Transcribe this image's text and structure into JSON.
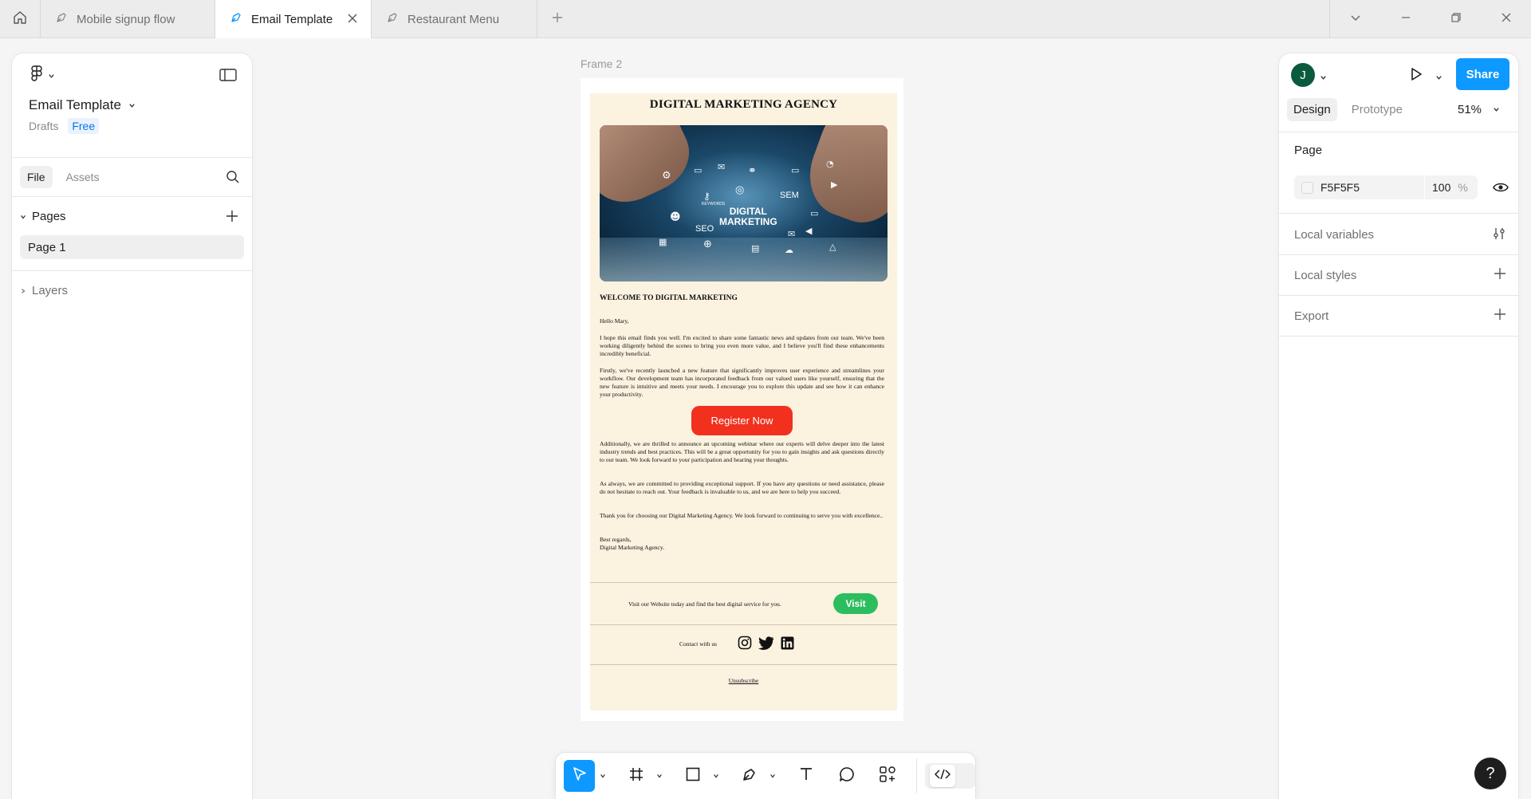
{
  "tabs": [
    {
      "label": "Mobile signup flow"
    },
    {
      "label": "Email Template"
    },
    {
      "label": "Restaurant Menu"
    }
  ],
  "file": {
    "name": "Email Template",
    "location": "Drafts",
    "plan": "Free"
  },
  "left_panel": {
    "tabs": {
      "file": "File",
      "assets": "Assets"
    },
    "pages_title": "Pages",
    "pages": [
      "Page 1"
    ],
    "layers_title": "Layers"
  },
  "canvas": {
    "frame_label": "Frame 2"
  },
  "email": {
    "title": "DIGITAL MARKETING AGENCY",
    "hero": {
      "main_text_line1": "DIGITAL",
      "main_text_line2": "MARKETING",
      "seo": "SEO",
      "sem": "SEM",
      "keywords": "KEYWORDS"
    },
    "welcome": "WELCOME TO DIGITAL MARKETING",
    "greeting": "Hello Mary,",
    "p1": "I hope this email finds you well. I'm excited to share some fantastic news and updates from our team. We've been working diligently behind the scenes to bring you even more value, and I believe you'll find these enhancements incredibly beneficial.",
    "p2": "Firstly, we've recently launched a new feature that significantly improves user experience and streamlines your workflow. Our development team has incorporated feedback from our valued users like yourself, ensuring that the new feature is intuitive and meets your needs. I encourage you to explore this update and see how it can enhance your productivity.",
    "register_button": "Register Now",
    "p3": "Additionally, we are thrilled to announce an upcoming webinar where our experts will delve deeper into the latest industry trends and best practices. This will be a great opportunity for you to gain insights and ask questions directly to our team. We look forward to your participation and hearing your thoughts.",
    "p4": "As always, we are committed to providing exceptional support. If you have any questions or need assistance, please do not hesitate to reach out. Your feedback is invaluable to us, and we are here to help you succeed.",
    "p5": "Thank you for choosing our Digital Marketing Agency. We look forward to continuing to serve you with excellence..",
    "signoff_line1": "Best regards,",
    "signoff_line2": "Digital Marketing Agency.",
    "visit_text": "Visit our Website today and find the best digital service for you.",
    "visit_button": "Visit",
    "contact_text": "Contact with us",
    "unsubscribe": "Unsubscribe"
  },
  "right_panel": {
    "avatar_initial": "J",
    "share_button": "Share",
    "tabs": {
      "design": "Design",
      "prototype": "Prototype"
    },
    "zoom": "51%",
    "page_section_title": "Page",
    "page_color_hex": "F5F5F5",
    "page_opacity": "100",
    "percent_sign": "%",
    "local_variables": "Local variables",
    "local_styles": "Local styles",
    "export": "Export"
  },
  "help_button": "?",
  "colors": {
    "accent": "#0d99ff",
    "register_button": "#f1301d",
    "visit_button": "#2cbd5e",
    "email_background": "#fbf2e0",
    "page_background": "#F5F5F5"
  }
}
